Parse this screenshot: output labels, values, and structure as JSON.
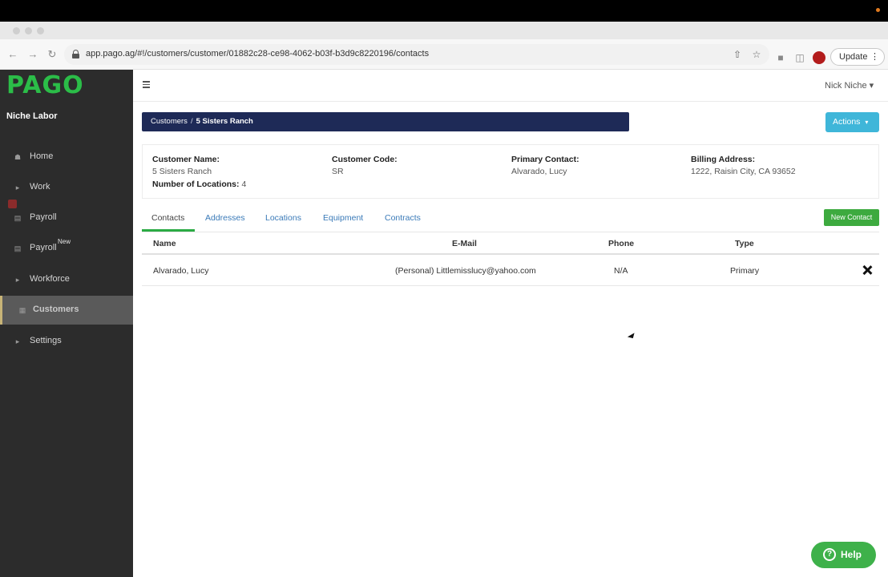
{
  "browser": {
    "url": "app.pago.ag/#!/customers/customer/01882c28-ce98-4062-b03f-b3d9c8220196/contacts",
    "update_label": "Update",
    "icons": [
      "back-icon",
      "forward-icon",
      "reload-icon",
      "lock-icon",
      "share-icon",
      "star-icon",
      "extensions-icon",
      "sidepanel-icon",
      "profile-icon",
      "more-icon"
    ]
  },
  "sidebar": {
    "logo": "PAGO",
    "org_name": "Niche Labor",
    "items": [
      {
        "label": "Home",
        "icon": "home-icon"
      },
      {
        "label": "Work",
        "icon": "caret-right-icon"
      },
      {
        "label": "Payroll",
        "icon": "money-icon"
      },
      {
        "label": "Payroll",
        "sup": "New",
        "icon": "money-icon"
      },
      {
        "label": "Workforce",
        "icon": "caret-right-icon"
      },
      {
        "label": "Customers",
        "icon": "building-icon",
        "active": true
      },
      {
        "label": "Settings",
        "icon": "caret-right-icon"
      }
    ]
  },
  "header": {
    "user": "Nick Niche"
  },
  "breadcrumb": {
    "root": "Customers",
    "separator": "/",
    "current": "5 Sisters Ranch"
  },
  "actions_label": "Actions",
  "customer": {
    "name_label": "Customer Name:",
    "name": "5 Sisters Ranch",
    "code_label": "Customer Code:",
    "code": "SR",
    "contact_label": "Primary Contact:",
    "contact": "Alvarado, Lucy",
    "billing_label": "Billing Address:",
    "billing": "1222, Raisin City, CA 93652",
    "locations_label": "Number of Locations:",
    "locations": "4"
  },
  "tabs": [
    "Contacts",
    "Addresses",
    "Locations",
    "Equipment",
    "Contracts"
  ],
  "new_contact_label": "New Contact",
  "table": {
    "headers": [
      "Name",
      "E-Mail",
      "Phone",
      "Type"
    ],
    "rows": [
      {
        "name": "Alvarado, Lucy",
        "email": "(Personal) Littlemisslucy@yahoo.com",
        "phone": "N/A",
        "type": "Primary"
      }
    ]
  },
  "help_label": "Help",
  "colors": {
    "brand_green": "#2bbd48",
    "sidebar_bg": "#2c2c2c",
    "breadcrumb_bg": "#1e2a57",
    "actions_bg": "#3fb6d9",
    "new_contact_bg": "#3daa3f",
    "link_blue": "#3a7ab8"
  }
}
